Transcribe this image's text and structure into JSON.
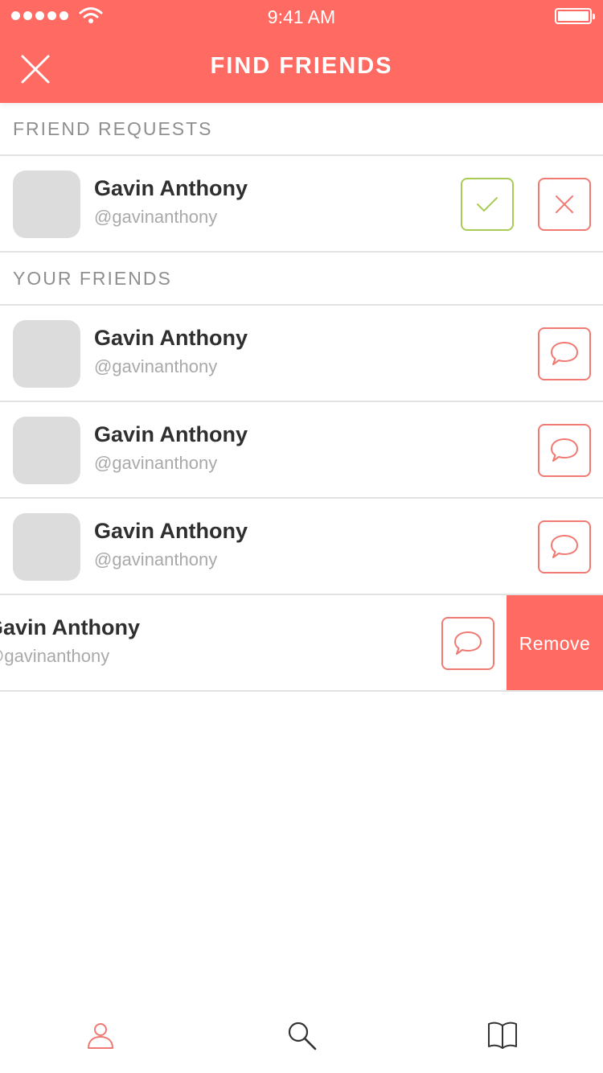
{
  "status_bar": {
    "time": "9:41 AM"
  },
  "header": {
    "title": "FIND FRIENDS"
  },
  "sections": {
    "requests_label": "FRIEND REQUESTS",
    "friends_label": "YOUR FRIENDS"
  },
  "friend_requests": [
    {
      "name": "Gavin Anthony",
      "handle": "@gavinanthony"
    }
  ],
  "friends": [
    {
      "name": "Gavin Anthony",
      "handle": "@gavinanthony"
    },
    {
      "name": "Gavin Anthony",
      "handle": "@gavinanthony"
    },
    {
      "name": "Gavin Anthony",
      "handle": "@gavinanthony"
    },
    {
      "name": "Gavin Anthony",
      "handle": "@gavinanthony",
      "remove_label": "Remove"
    }
  ],
  "colors": {
    "accent": "#FF6B63",
    "accept": "#A8CC55",
    "avatar_placeholder": "#DCDCDC"
  },
  "icons": {
    "close": "close-icon",
    "accept": "check-icon",
    "decline": "x-icon",
    "message": "chat-bubble-icon",
    "tab_profile": "person-icon",
    "tab_search": "search-icon",
    "tab_library": "book-icon"
  },
  "tabbar": {
    "active": "profile"
  }
}
